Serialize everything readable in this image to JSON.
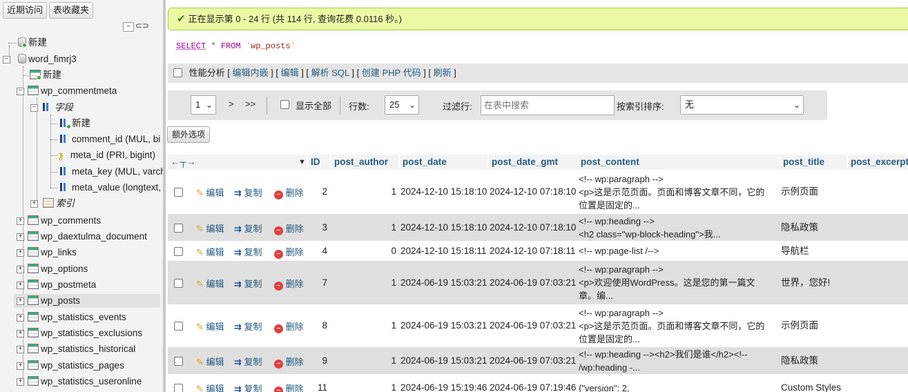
{
  "topnav": {
    "recent": "近期访问",
    "favorites": "表收藏夹"
  },
  "tree": {
    "new_root": "新建",
    "db_name": "word_fimrj3",
    "db_new": "新建",
    "commentmeta": "wp_commentmeta",
    "fields_label": "字段",
    "fields_new": "新建",
    "columns": [
      "comment_id (MUL, bi",
      "meta_id (PRI, bigint)",
      "meta_key (MUL, varch",
      "meta_value (longtext,"
    ],
    "index_label": "索引",
    "tables": [
      "wp_comments",
      "wp_daextulma_document",
      "wp_links",
      "wp_options",
      "wp_postmeta",
      "wp_posts",
      "wp_statistics_events",
      "wp_statistics_exclusions",
      "wp_statistics_historical",
      "wp_statistics_pages",
      "wp_statistics_useronline"
    ]
  },
  "success_msg": "正在显示第 0 - 24 行 (共 114 行, 查询花费 0.0116 秒。)",
  "sql": {
    "select": "SELECT",
    "star": "*",
    "from": "FROM",
    "table": "`wp_posts`"
  },
  "toolbar": {
    "profiling": "性能分析",
    "inline_edit": "编辑内嵌",
    "edit": "编辑",
    "explain": "解析 SQL",
    "php": "创建 PHP 代码",
    "refresh": "刷新"
  },
  "nav": {
    "page": "1",
    "next": ">",
    "last": ">>",
    "show_all": "显示全部",
    "rows_label": "行数:",
    "rows_value": "25",
    "filter_label": "过滤行:",
    "filter_placeholder": "在表中搜索",
    "sort_label": "按索引排序:",
    "sort_value": "无"
  },
  "extra_options": "额外选项",
  "columns": [
    "ID",
    "post_author",
    "post_date",
    "post_date_gmt",
    "post_content",
    "post_title",
    "post_excerpt"
  ],
  "actions": {
    "edit": "编辑",
    "copy": "复制",
    "delete": "删除"
  },
  "rows": [
    {
      "id": "2",
      "author": "1",
      "date": "2024-12-10 15:18:10",
      "gmt": "2024-12-10 07:18:10",
      "content": [
        "<!-- wp:paragraph -->",
        "<p>这是示范页面。页面和博客文章不同，它的",
        "位置是固定的..."
      ],
      "title": "示例页面"
    },
    {
      "id": "3",
      "author": "1",
      "date": "2024-12-10 15:18:10",
      "gmt": "2024-12-10 07:18:10",
      "content": [
        "<!-- wp:heading -->",
        "<h2 class=\"wp-block-heading\">我..."
      ],
      "title": "隐私政策"
    },
    {
      "id": "4",
      "author": "0",
      "date": "2024-12-10 15:18:11",
      "gmt": "2024-12-10 07:18:11",
      "content": [
        "<!-- wp:page-list /-->"
      ],
      "title": "导航栏"
    },
    {
      "id": "7",
      "author": "1",
      "date": "2024-06-19 15:03:21",
      "gmt": "2024-06-19 07:03:21",
      "content": [
        "<!-- wp:paragraph -->",
        "<p>欢迎使用WordPress。这是您的第一篇文",
        "章。编..."
      ],
      "title": "世界，您好!"
    },
    {
      "id": "8",
      "author": "1",
      "date": "2024-06-19 15:03:21",
      "gmt": "2024-06-19 07:03:21",
      "content": [
        "<!-- wp:paragraph -->",
        "<p>这是示范页面。页面和博客文章不同，它的",
        "位置是固定的..."
      ],
      "title": "示例页面"
    },
    {
      "id": "9",
      "author": "1",
      "date": "2024-06-19 15:03:21",
      "gmt": "2024-06-19 07:03:21",
      "content": [
        "<!-- wp:heading --><h2>我们是谁</h2><!--",
        "/wp:heading -..."
      ],
      "title": "隐私政策"
    },
    {
      "id": "11",
      "author": "1",
      "date": "2024-06-19 15:19:46",
      "gmt": "2024-06-19 07:19:46",
      "content": [
        "{\"version\": 2,"
      ],
      "title": "Custom Styles"
    }
  ]
}
